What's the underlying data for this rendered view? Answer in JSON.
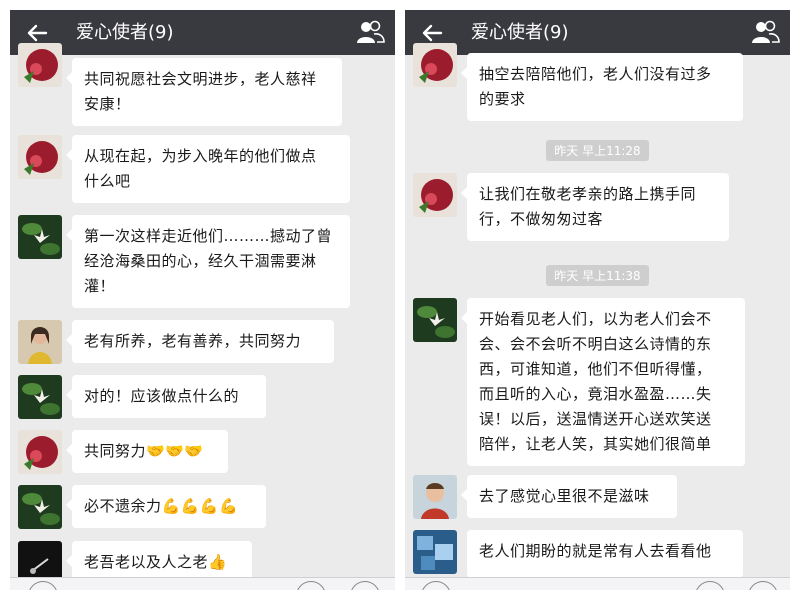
{
  "left": {
    "header": {
      "title": "爱心使者(9)"
    },
    "messages": [
      {
        "avatar": "pomegranate-avatar",
        "text": "共同祝愿社会文明进步，老人慈祥\n安康！"
      },
      {
        "avatar": "pomegranate-avatar",
        "text": "从现在起，为步入晚年的他们做点\n什么吧"
      },
      {
        "avatar": "lotus-avatar",
        "text": "第一次这样走近他们………撼动了曾\n经沧海桑田的心，经久干涸需要淋\n灌！"
      },
      {
        "avatar": "woman-photo-avatar",
        "text": "老有所养，老有善养，共同努力"
      },
      {
        "avatar": "lotus-avatar",
        "text": "对的！应该做点什么的"
      },
      {
        "avatar": "pomegranate-avatar",
        "text": "共同努力🤝🤝🤝"
      },
      {
        "avatar": "lotus-avatar",
        "text": "必不遗余力💪💪💪💪"
      },
      {
        "avatar": "dark-hand-avatar",
        "text": "老吾老以及人之老👍"
      }
    ]
  },
  "right": {
    "header": {
      "title": "爱心使者(9)"
    },
    "messages": [
      {
        "avatar": "pomegranate-avatar",
        "text": "抽空去陪陪他们，老人们没有过多\n的要求"
      },
      {
        "time": "昨天 早上11:28"
      },
      {
        "avatar": "pomegranate-avatar",
        "text": "让我们在敬老孝亲的路上携手同\n行，不做匆匆过客"
      },
      {
        "time": "昨天 早上11:38"
      },
      {
        "avatar": "lotus-avatar",
        "text": "开始看见老人们，以为老人们会不\n会、会不会听不明白这么诗情的东\n西，可谁知道，他们不但听得懂，\n而且听的入心，竟泪水盈盈……失\n误！以后，送温情送开心送欢笑送\n陪伴，让老人笑，其实她们很简单"
      },
      {
        "avatar": "child-photo-avatar",
        "text": "去了感觉心里很不是滋味"
      },
      {
        "avatar": "blue-cubes-avatar",
        "text": "老人们期盼的就是常有人去看看他"
      }
    ]
  },
  "colors": {
    "header": "#393a3f",
    "chat_bg": "#ebebeb",
    "bubble": "#ffffff"
  }
}
